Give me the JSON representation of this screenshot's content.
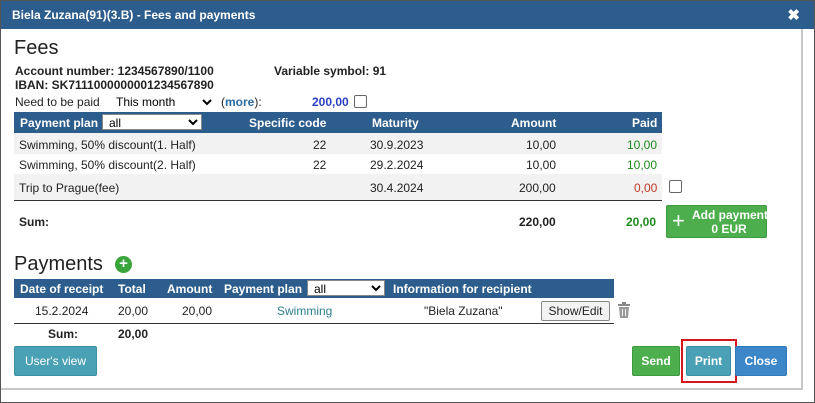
{
  "dialog": {
    "title": "Biela Zuzana(91)(3.B) - Fees and payments",
    "close_glyph": "✖"
  },
  "fees": {
    "heading": "Fees",
    "account_number": "Account number: 1234567890/1100",
    "iban": "IBAN: SK7111000000001234567890",
    "variable_symbol": "Variable symbol: 91",
    "need_label": "Need to be paid",
    "need_select": "This month",
    "more_prefix": "(",
    "more_link": "more",
    "more_suffix": "):",
    "need_amount": "200,00",
    "table": {
      "headers": {
        "payment_plan": "Payment plan",
        "plan_filter": "all",
        "specific_code": "Specific code",
        "maturity": "Maturity",
        "amount": "Amount",
        "paid": "Paid"
      },
      "rows": [
        {
          "name": "Swimming, 50% discount(1. Half)",
          "code": "22",
          "maturity": "30.9.2023",
          "amount": "10,00",
          "paid": "10,00",
          "paid_color": "green"
        },
        {
          "name": "Swimming, 50% discount(2. Half)",
          "code": "22",
          "maturity": "29.2.2024",
          "amount": "10,00",
          "paid": "10,00",
          "paid_color": "green"
        },
        {
          "name": "Trip to Prague(fee)",
          "code": "",
          "maturity": "30.4.2024",
          "amount": "200,00",
          "paid": "0,00",
          "paid_color": "red"
        }
      ],
      "sum_label": "Sum:",
      "sum_amount": "220,00",
      "sum_paid": "20,00"
    },
    "add_payment": {
      "line1": "Add payment",
      "line2": "0 EUR"
    }
  },
  "payments": {
    "heading": "Payments",
    "table": {
      "headers": {
        "date": "Date of receipt",
        "total": "Total",
        "amount": "Amount",
        "plan": "Payment plan",
        "plan_filter": "all",
        "info": "Information for recipient"
      },
      "rows": [
        {
          "date": "15.2.2024",
          "total": "20,00",
          "amount": "20,00",
          "plan": "Swimming",
          "info": "\"Biela Zuzana\"",
          "action": "Show/Edit"
        }
      ],
      "sum_label": "Sum:",
      "sum_total": "20,00"
    }
  },
  "footer": {
    "users_view": "User's view",
    "send": "Send",
    "print": "Print",
    "close": "Close"
  },
  "colors": {
    "header_bg": "#2d5d8c",
    "paid_green": "#1e8a1e",
    "unpaid_red": "#c0392b",
    "highlight": "#d4181e"
  }
}
